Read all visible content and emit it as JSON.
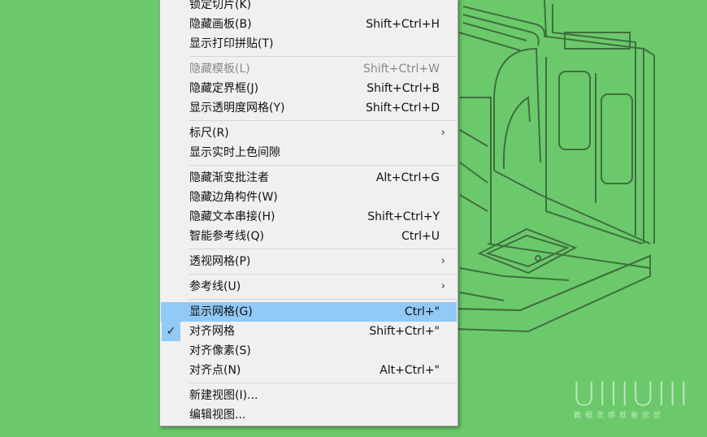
{
  "menu": {
    "items": [
      {
        "label": "锁定切片(K)",
        "shortcut": ""
      },
      {
        "label": "隐藏画板(B)",
        "shortcut": "Shift+Ctrl+H"
      },
      {
        "label": "显示打印拼贴(T)",
        "shortcut": ""
      },
      {
        "label": "隐藏模板(L)",
        "shortcut": "Shift+Ctrl+W",
        "disabled": true
      },
      {
        "label": "隐藏定界框(J)",
        "shortcut": "Shift+Ctrl+B"
      },
      {
        "label": "显示透明度网格(Y)",
        "shortcut": "Shift+Ctrl+D"
      },
      {
        "label": "标尺(R)",
        "shortcut": "",
        "submenu": true
      },
      {
        "label": "显示实时上色间隙",
        "shortcut": ""
      },
      {
        "label": "隐藏渐变批注者",
        "shortcut": "Alt+Ctrl+G"
      },
      {
        "label": "隐藏边角构件(W)",
        "shortcut": ""
      },
      {
        "label": "隐藏文本串接(H)",
        "shortcut": "Shift+Ctrl+Y"
      },
      {
        "label": "智能参考线(Q)",
        "shortcut": "Ctrl+U"
      },
      {
        "label": "透视网格(P)",
        "shortcut": "",
        "submenu": true
      },
      {
        "label": "参考线(U)",
        "shortcut": "",
        "submenu": true
      },
      {
        "label": "显示网格(G)",
        "shortcut": "Ctrl+\"",
        "highlighted": true
      },
      {
        "label": "对齐网格",
        "shortcut": "Shift+Ctrl+\"",
        "checked": true
      },
      {
        "label": "对齐像素(S)",
        "shortcut": ""
      },
      {
        "label": "对齐点(N)",
        "shortcut": "Alt+Ctrl+\""
      },
      {
        "label": "新建视图(I)...",
        "shortcut": ""
      },
      {
        "label": "编辑视图...",
        "shortcut": ""
      }
    ],
    "submenu_glyph": "›",
    "check_glyph": "✓"
  },
  "watermark": {
    "logo": "UIIIUIII",
    "tagline": "教程灵感就看优优"
  },
  "colors": {
    "background": "#6bc96b",
    "menu_bg": "#f0f0f0",
    "highlight": "#91c9f7",
    "line_art": "#3b6e3b"
  }
}
